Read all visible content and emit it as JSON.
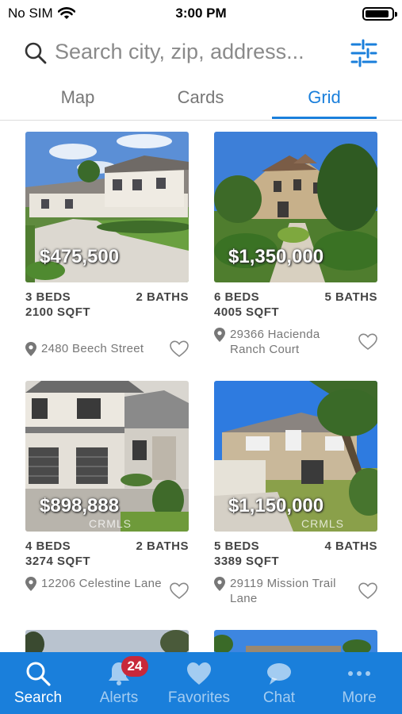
{
  "status_bar": {
    "carrier": "No SIM",
    "time": "3:00 PM",
    "battery_level": 0.9
  },
  "search": {
    "placeholder": "Search city, zip, address..."
  },
  "tabs": [
    {
      "label": "Map",
      "active": false
    },
    {
      "label": "Cards",
      "active": false
    },
    {
      "label": "Grid",
      "active": true
    }
  ],
  "listings": [
    {
      "price": "$475,500",
      "beds": "3 BEDS",
      "baths": "2 BATHS",
      "sqft": "2100 SQFT",
      "address": "2480 Beech Street",
      "watermark": ""
    },
    {
      "price": "$1,350,000",
      "beds": "6 BEDS",
      "baths": "5 BATHS",
      "sqft": "4005 SQFT",
      "address": "29366 Hacienda Ranch Court",
      "watermark": ""
    },
    {
      "price": "$898,888",
      "beds": "4 BEDS",
      "baths": "2 BATHS",
      "sqft": "3274 SQFT",
      "address": "12206 Celestine Lane",
      "watermark": "CRMLS"
    },
    {
      "price": "$1,150,000",
      "beds": "5 BEDS",
      "baths": "4 BATHS",
      "sqft": "3389 SQFT",
      "address": "29119 Mission Trail Lane",
      "watermark": "CRMLS"
    }
  ],
  "bottom_nav": [
    {
      "label": "Search",
      "icon": "search-icon",
      "active": true
    },
    {
      "label": "Alerts",
      "icon": "bell-icon",
      "active": false,
      "badge": "24"
    },
    {
      "label": "Favorites",
      "icon": "heart-icon",
      "active": false
    },
    {
      "label": "Chat",
      "icon": "chat-bubble-icon",
      "active": false
    },
    {
      "label": "More",
      "icon": "more-dots-icon",
      "active": false
    }
  ],
  "colors": {
    "accent": "#1a7fdb",
    "badge": "#c8283a"
  }
}
